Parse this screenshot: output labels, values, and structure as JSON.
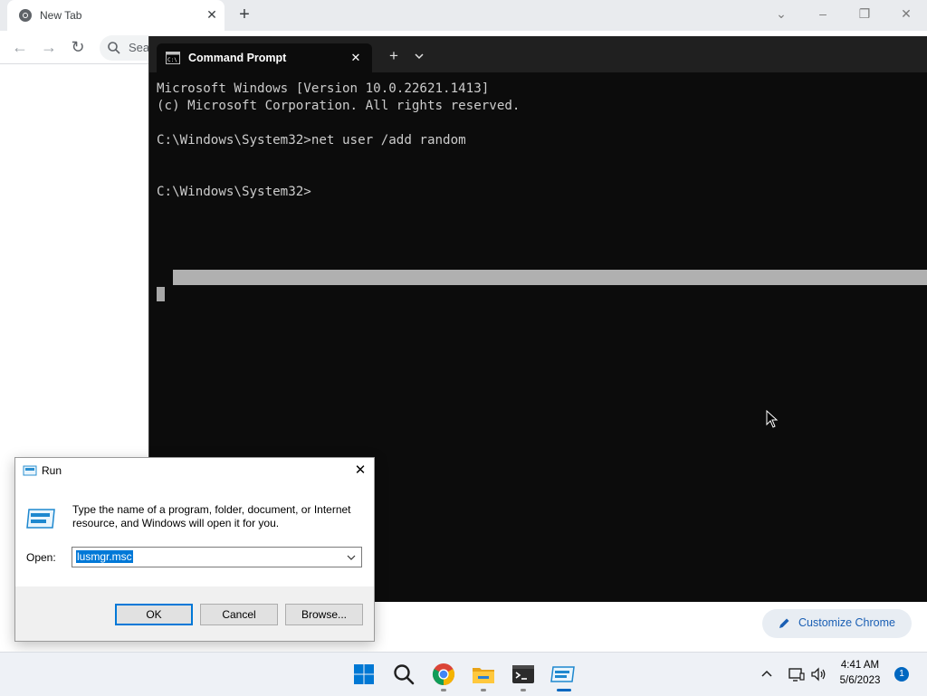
{
  "chrome": {
    "tab_title": "New Tab",
    "omnibox_partial_placeholder": "Sea",
    "customize_label": "Customize Chrome",
    "colors": {
      "tabstrip": "#e9ebee",
      "accent": "#1a5fb4"
    }
  },
  "terminal": {
    "tab_title": "Command Prompt",
    "lines": [
      "Microsoft Windows [Version 10.0.22621.1413]",
      "(c) Microsoft Corporation. All rights reserved.",
      "",
      "C:\\Windows\\System32>net user /add random",
      "",
      "",
      "C:\\Windows\\System32>"
    ],
    "colors": {
      "background": "#0c0c0c",
      "text": "#cccccc"
    }
  },
  "run_dialog": {
    "title": "Run",
    "description": "Type the name of a program, folder, document, or Internet resource, and Windows will open it for you.",
    "open_label": "Open:",
    "input_value": "lusmgr.msc",
    "ok_label": "OK",
    "cancel_label": "Cancel",
    "browse_label": "Browse..."
  },
  "taskbar": {
    "apps": [
      "start-icon",
      "search-icon",
      "chrome-icon",
      "file-explorer-icon",
      "terminal-icon",
      "run-icon"
    ],
    "time": "4:41 AM",
    "date": "5/6/2023",
    "notification_count": "1",
    "accent": "#0067c0"
  }
}
